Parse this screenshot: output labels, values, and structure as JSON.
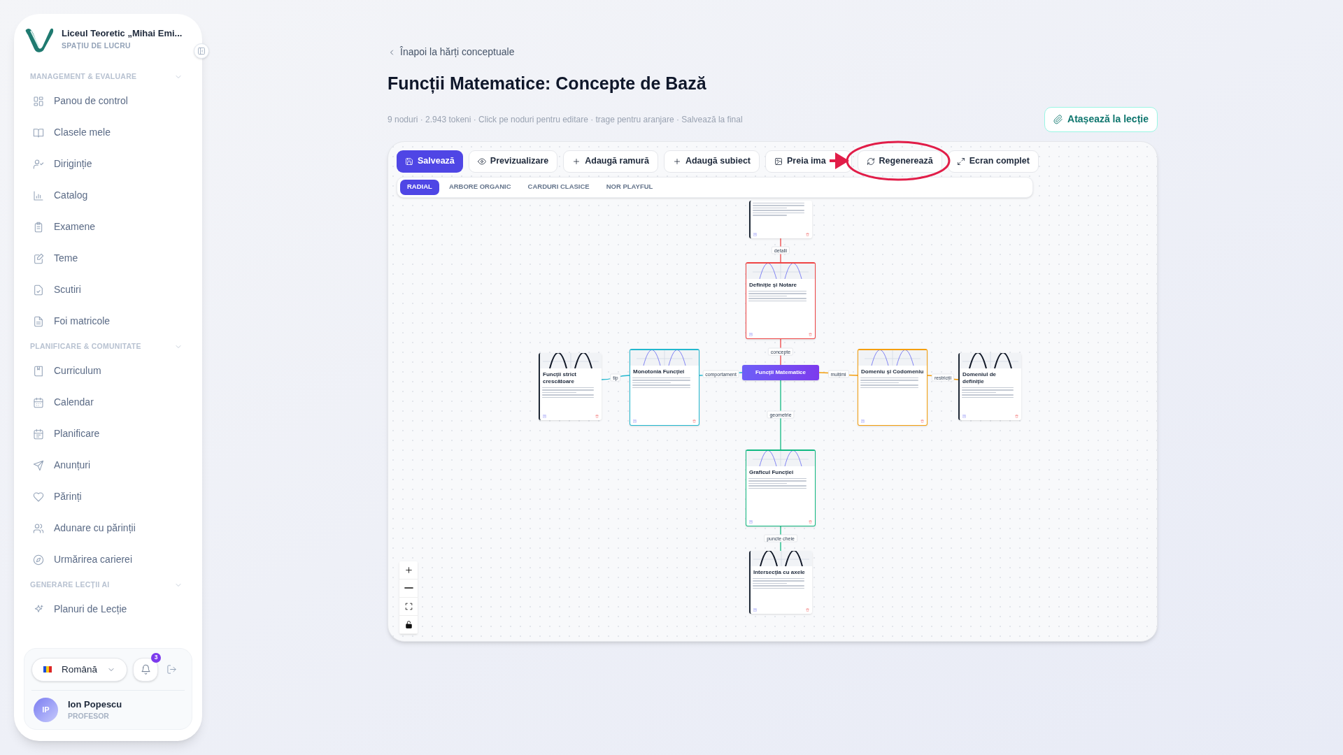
{
  "sidebar": {
    "school": "Liceul Teoretic „Mihai Emi...",
    "workspace": "SPAȚIU DE LUCRU",
    "sections": [
      {
        "title": "MANAGEMENT & EVALUARE",
        "expanded": true,
        "items": [
          "Panou de control",
          "Clasele mele",
          "Diriginție",
          "Catalog",
          "Examene",
          "Teme",
          "Scutiri",
          "Foi matricole"
        ]
      },
      {
        "title": "PLANIFICARE & COMUNITATE",
        "expanded": true,
        "items": [
          "Curriculum",
          "Calendar",
          "Planificare",
          "Anunțuri",
          "Părinți",
          "Adunare cu părinții",
          "Urmărirea carierei"
        ]
      },
      {
        "title": "GENERARE LECȚII AI",
        "expanded": true,
        "items": [
          "Planuri de Lecție"
        ]
      }
    ],
    "language": "Română",
    "notifications": "3",
    "user": {
      "initials": "IP",
      "name": "Ion Popescu",
      "role": "PROFESOR"
    }
  },
  "back_link": "Înapoi la hărți conceptuale",
  "title": "Funcții Matematice: Concepte de Bază",
  "subtitle": "9 noduri · 2.943 tokeni · Click pe noduri pentru editare · trage pentru aranjare · Salvează la final",
  "attach_button": "Atașează la lecție",
  "toolbar": [
    {
      "label": "Salvează",
      "kind": "primary"
    },
    {
      "label": "Previzualizare",
      "kind": "preview"
    },
    {
      "label": "Adaugă ramură",
      "kind": "add"
    },
    {
      "label": "Adaugă subiect",
      "kind": "add"
    },
    {
      "label": "Preia ima",
      "kind": "image"
    },
    {
      "label": "Regenerează",
      "kind": "regenerate"
    },
    {
      "label": "Ecran complet",
      "kind": "fullscreen"
    }
  ],
  "layouts": [
    {
      "label": "RADIAL",
      "selected": true
    },
    {
      "label": "ARBORE ORGANIC",
      "selected": false
    },
    {
      "label": "CARDURI CLASICE",
      "selected": false
    },
    {
      "label": "NOR PLAYFUL",
      "selected": false
    }
  ],
  "map": {
    "center": "Funcții Matematice",
    "nodes": [
      {
        "color": "#1f2937"
      },
      {
        "title": "Definiție și Notare",
        "color": "#ef4444"
      },
      {
        "title": "Monotonia Funcției",
        "color": "#22b8cf"
      },
      {
        "title": "Funcții strict crescătoare",
        "color": "#1f2937"
      },
      {
        "title": "Domeniu și Codomeniu",
        "color": "#f59e0b"
      },
      {
        "title": "Domeniul de definiție",
        "color": "#1f2937"
      },
      {
        "title": "Graficul Funcției",
        "color": "#10b981"
      },
      {
        "title": "Intersecția cu axele",
        "color": "#1f2937"
      }
    ],
    "edges": [
      "detalii",
      "concepte",
      "comportament",
      "tip",
      "mulțimi",
      "restricții",
      "geometrie",
      "puncte cheie"
    ]
  }
}
